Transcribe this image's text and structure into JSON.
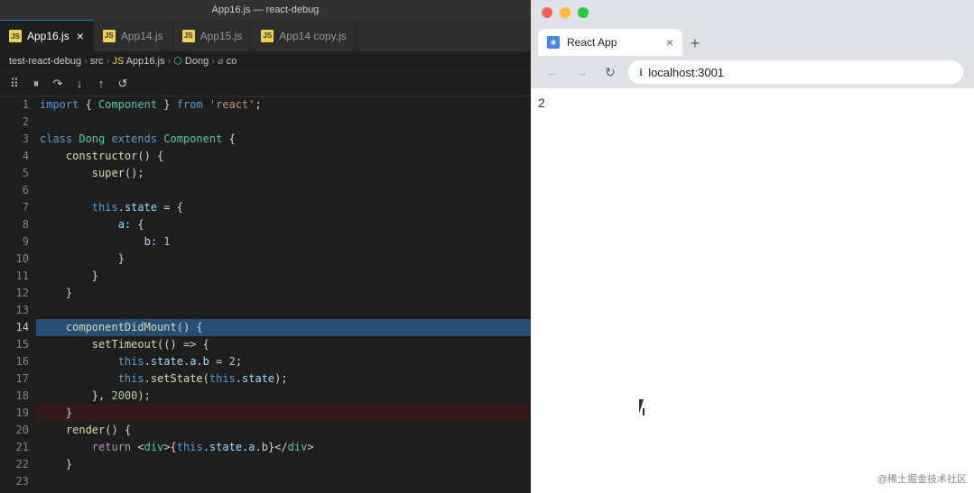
{
  "window": {
    "title": "App16.js — react-debug"
  },
  "vscode": {
    "tabs": [
      {
        "id": "app16",
        "label": "App16.js",
        "active": true,
        "closeable": true
      },
      {
        "id": "app14",
        "label": "App14.js",
        "active": false,
        "closeable": false
      },
      {
        "id": "app15",
        "label": "App15.js",
        "active": false,
        "closeable": false
      },
      {
        "id": "app14copy",
        "label": "App14 copy.js",
        "active": false,
        "closeable": false
      }
    ],
    "breadcrumb": "test-react-debug > src > App16.js > Dong > co",
    "debug_toolbar": {
      "buttons": [
        "⠿",
        "⏸",
        "↷",
        "↓",
        "↑",
        "↺"
      ]
    },
    "lines": [
      {
        "num": 1,
        "tokens": [
          {
            "t": "kw",
            "v": "import"
          },
          {
            "t": "op",
            "v": " { "
          },
          {
            "t": "cls",
            "v": "Component"
          },
          {
            "t": "op",
            "v": " } "
          },
          {
            "t": "kw",
            "v": "from"
          },
          {
            "t": "op",
            "v": " "
          },
          {
            "t": "str",
            "v": "'react'"
          },
          {
            "t": "op",
            "v": ";"
          }
        ]
      },
      {
        "num": 2,
        "tokens": []
      },
      {
        "num": 3,
        "tokens": [
          {
            "t": "kw",
            "v": "class"
          },
          {
            "t": "op",
            "v": " "
          },
          {
            "t": "cls",
            "v": "Dong"
          },
          {
            "t": "op",
            "v": " "
          },
          {
            "t": "kw",
            "v": "extends"
          },
          {
            "t": "op",
            "v": " "
          },
          {
            "t": "cls",
            "v": "Component"
          },
          {
            "t": "op",
            "v": " {"
          }
        ]
      },
      {
        "num": 4,
        "tokens": [
          {
            "t": "op",
            "v": "    "
          },
          {
            "t": "fn",
            "v": "constructor"
          },
          {
            "t": "op",
            "v": "() {"
          }
        ]
      },
      {
        "num": 5,
        "tokens": [
          {
            "t": "op",
            "v": "        "
          },
          {
            "t": "fn",
            "v": "super"
          },
          {
            "t": "op",
            "v": "();"
          }
        ]
      },
      {
        "num": 6,
        "tokens": []
      },
      {
        "num": 7,
        "tokens": [
          {
            "t": "op",
            "v": "        "
          },
          {
            "t": "kw",
            "v": "this"
          },
          {
            "t": "op",
            "v": "."
          },
          {
            "t": "prop",
            "v": "state"
          },
          {
            "t": "op",
            "v": " = {"
          }
        ]
      },
      {
        "num": 8,
        "tokens": [
          {
            "t": "op",
            "v": "            "
          },
          {
            "t": "prop",
            "v": "a"
          },
          {
            "t": "op",
            "v": ": {"
          }
        ]
      },
      {
        "num": 9,
        "tokens": [
          {
            "t": "op",
            "v": "                "
          },
          {
            "t": "prop",
            "v": "b"
          },
          {
            "t": "op",
            "v": ": "
          },
          {
            "t": "num",
            "v": "1"
          }
        ]
      },
      {
        "num": 10,
        "tokens": [
          {
            "t": "op",
            "v": "            }"
          }
        ]
      },
      {
        "num": 11,
        "tokens": [
          {
            "t": "op",
            "v": "        }"
          }
        ]
      },
      {
        "num": 12,
        "tokens": [
          {
            "t": "op",
            "v": "    }"
          }
        ]
      },
      {
        "num": 13,
        "tokens": []
      },
      {
        "num": 14,
        "tokens": [
          {
            "t": "op",
            "v": "    "
          },
          {
            "t": "fn",
            "v": "componentDidMount"
          },
          {
            "t": "op",
            "v": "() {"
          },
          {
            "t": "op",
            "v": " "
          }
        ],
        "highlighted": true
      },
      {
        "num": 15,
        "tokens": [
          {
            "t": "op",
            "v": "        "
          },
          {
            "t": "fn",
            "v": "setTimeout"
          },
          {
            "t": "op",
            "v": "("
          },
          {
            "t": "op",
            "v": "() => {"
          }
        ]
      },
      {
        "num": 16,
        "tokens": [
          {
            "t": "op",
            "v": "            "
          },
          {
            "t": "kw",
            "v": "this"
          },
          {
            "t": "op",
            "v": "."
          },
          {
            "t": "prop",
            "v": "state"
          },
          {
            "t": "op",
            "v": "."
          },
          {
            "t": "prop",
            "v": "a"
          },
          {
            "t": "op",
            "v": "."
          },
          {
            "t": "prop",
            "v": "b"
          },
          {
            "t": "op",
            "v": " = "
          },
          {
            "t": "num",
            "v": "2"
          },
          {
            "t": "op",
            "v": ";"
          }
        ]
      },
      {
        "num": 17,
        "tokens": [
          {
            "t": "op",
            "v": "            "
          },
          {
            "t": "kw",
            "v": "this"
          },
          {
            "t": "op",
            "v": "."
          },
          {
            "t": "fn",
            "v": "setState"
          },
          {
            "t": "op",
            "v": "("
          },
          {
            "t": "kw",
            "v": "this"
          },
          {
            "t": "op",
            "v": "."
          },
          {
            "t": "prop",
            "v": "state"
          },
          {
            "t": "op",
            "v": ");"
          }
        ]
      },
      {
        "num": 18,
        "tokens": [
          {
            "t": "op",
            "v": "        }, "
          },
          {
            "t": "num",
            "v": "2000"
          },
          {
            "t": "op",
            "v": ");"
          }
        ]
      },
      {
        "num": 19,
        "tokens": [
          {
            "t": "op",
            "v": "    }"
          }
        ],
        "breakpoint": true
      },
      {
        "num": 20,
        "tokens": [
          {
            "t": "op",
            "v": "    "
          },
          {
            "t": "fn",
            "v": "render"
          },
          {
            "t": "op",
            "v": "() {"
          }
        ]
      },
      {
        "num": 21,
        "tokens": [
          {
            "t": "op",
            "v": "        "
          },
          {
            "t": "kw2",
            "v": "return"
          },
          {
            "t": "op",
            "v": " "
          },
          {
            "t": "op",
            "v": "<"
          },
          {
            "t": "tag",
            "v": "div"
          },
          {
            "t": "op",
            "v": ">"
          },
          {
            "t": "op",
            "v": "{"
          },
          {
            "t": "kw",
            "v": "this"
          },
          {
            "t": "op",
            "v": "."
          },
          {
            "t": "prop",
            "v": "state"
          },
          {
            "t": "op",
            "v": "."
          },
          {
            "t": "prop",
            "v": "a"
          },
          {
            "t": "op",
            "v": "."
          },
          {
            "t": "prop",
            "v": "b"
          },
          {
            "t": "op",
            "v": "}"
          },
          {
            "t": "op",
            "v": "</"
          },
          {
            "t": "tag",
            "v": "div"
          },
          {
            "t": "op",
            "v": ">"
          }
        ]
      },
      {
        "num": 22,
        "tokens": [
          {
            "t": "op",
            "v": "    }"
          }
        ]
      },
      {
        "num": 23,
        "tokens": []
      }
    ]
  },
  "browser": {
    "tab_title": "React App",
    "tab_close": "×",
    "new_tab": "+",
    "nav": {
      "back": "←",
      "forward": "→",
      "refresh": "↻",
      "url": "localhost:3001",
      "lock_icon": "🔒"
    },
    "content_text": "2",
    "watermark": "@稀土掘金技术社区"
  }
}
